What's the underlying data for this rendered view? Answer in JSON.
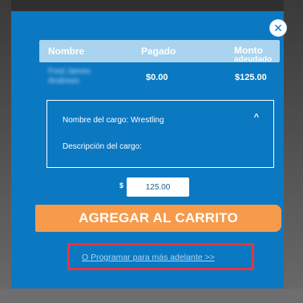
{
  "close": {
    "glyph": "✕"
  },
  "table": {
    "headers": {
      "name": "Nombre",
      "paid": "Pagado",
      "amount": "Monto",
      "amount_sub": "adeudado"
    },
    "row": {
      "name": "Fred James Andrews",
      "paid": "$0.00",
      "amount": "$125.00"
    }
  },
  "charge": {
    "name_label": "Nombre del cargo: Wrestling",
    "description_label": "Descripción del cargo:",
    "chevron": "^"
  },
  "payment": {
    "currency_symbol": "$",
    "amount_value": "125.00"
  },
  "actions": {
    "add_to_cart": "AGREGAR AL CARRITO",
    "schedule_later": "O Programar para más adelante >>"
  },
  "colors": {
    "modal_bg": "#0b78c2",
    "header_bg": "#a9d3ee",
    "button_orange": "#f69a4b",
    "highlight_red": "#e6363f"
  }
}
